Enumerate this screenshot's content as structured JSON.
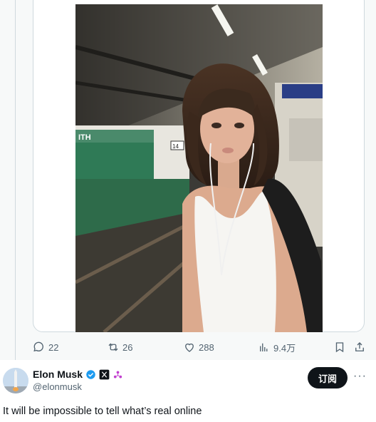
{
  "actions": {
    "reply_count": "22",
    "repost_count": "26",
    "like_count": "288",
    "views_count": "9.4万"
  },
  "author": {
    "display_name": "Elon Musk",
    "handle": "@elonmusk",
    "subscribe_label": "订阅",
    "more_label": "···"
  },
  "post": {
    "text": "It will be impossible to tell what’s real online"
  },
  "media": {
    "wall_sign_1": "ITH",
    "wall_sign_2": "14"
  },
  "colors": {
    "accent_dark": "#0f1419",
    "muted": "#536471",
    "verified_blue": "#1d9bf0",
    "divider": "#cfd9de"
  },
  "icons": [
    "reply-icon",
    "repost-icon",
    "like-icon",
    "views-icon",
    "bookmark-icon",
    "share-icon",
    "verified-icon",
    "x-logo-icon",
    "affiliate-icon",
    "more-icon"
  ]
}
